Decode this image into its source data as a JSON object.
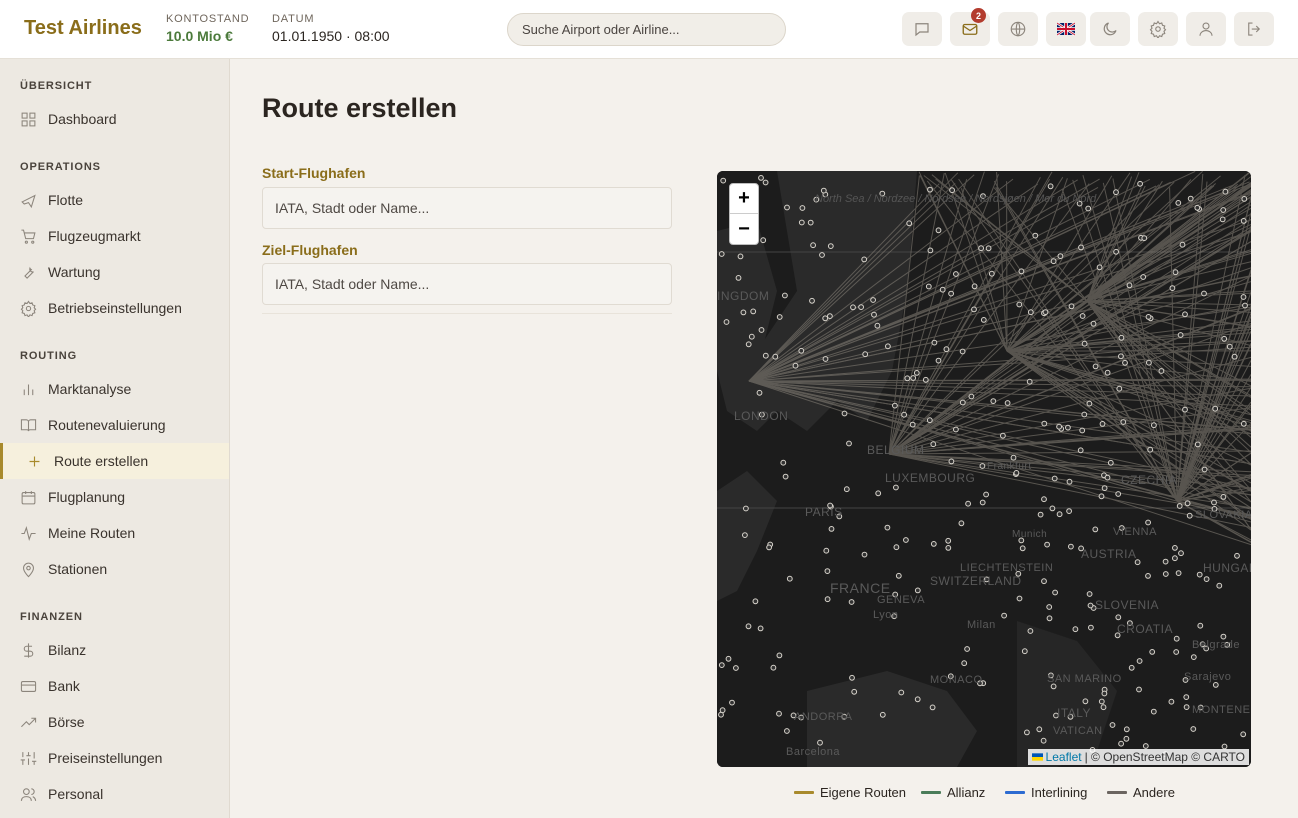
{
  "header": {
    "brand": "Test Airlines",
    "balance_label": "KONTOSTAND",
    "balance_value": "10.0 Mio €",
    "date_label": "DATUM",
    "date_value": "01.01.1950 · 08:00",
    "search_placeholder": "Suche Airport oder Airline...",
    "mail_badge": "2",
    "buttons": [
      "chat-icon",
      "mail-icon",
      "globe-icon",
      "uk-flag-icon",
      "moon-icon",
      "gear-icon",
      "user-icon",
      "logout-icon"
    ]
  },
  "sidebar": {
    "sections": [
      {
        "title": "ÜBERSICHT",
        "items": [
          {
            "label": "Dashboard",
            "icon": "grid-icon"
          }
        ]
      },
      {
        "title": "OPERATIONS",
        "items": [
          {
            "label": "Flotte",
            "icon": "plane-icon"
          },
          {
            "label": "Flugzeugmarkt",
            "icon": "cart-icon"
          },
          {
            "label": "Wartung",
            "icon": "wrench-icon"
          },
          {
            "label": "Betriebseinstellungen",
            "icon": "gear-icon"
          }
        ]
      },
      {
        "title": "ROUTING",
        "items": [
          {
            "label": "Marktanalyse",
            "icon": "bar-chart-icon"
          },
          {
            "label": "Routenevaluierung",
            "icon": "book-icon"
          },
          {
            "label": "Route erstellen",
            "icon": "plus-icon",
            "active": true
          },
          {
            "label": "Flugplanung",
            "icon": "calendar-icon"
          },
          {
            "label": "Meine Routen",
            "icon": "activity-icon"
          },
          {
            "label": "Stationen",
            "icon": "map-pin-icon"
          }
        ]
      },
      {
        "title": "FINANZEN",
        "items": [
          {
            "label": "Bilanz",
            "icon": "dollar-icon"
          },
          {
            "label": "Bank",
            "icon": "credit-card-icon"
          },
          {
            "label": "Börse",
            "icon": "trending-up-icon"
          },
          {
            "label": "Preiseinstellungen",
            "icon": "sliders-icon"
          },
          {
            "label": "Personal",
            "icon": "users-icon"
          }
        ]
      }
    ]
  },
  "main": {
    "title": "Route erstellen",
    "start_label": "Start-Flughafen",
    "start_placeholder": "IATA, Stadt oder Name...",
    "dest_label": "Ziel-Flughafen",
    "dest_placeholder": "IATA, Stadt oder Name..."
  },
  "map": {
    "zoom_in": "+",
    "zoom_out": "−",
    "attribution_leaflet": "Leaflet",
    "attribution_rest": "| © OpenStreetMap © CARTO",
    "labels": [
      "INGDOM",
      "LONDON",
      "BELGIUM",
      "LUXEMBOURG",
      "PARIS",
      "FRANCE",
      "SWITZERLAND",
      "LIECHTENSTEIN",
      "GENEVA",
      "Lyon",
      "AUSTRIA",
      "VIENNA",
      "SLOVENIA",
      "CROATIA",
      "ITALY",
      "VATICAN",
      "MONACO",
      "ANDORRA",
      "Barcelona",
      "Munich",
      "Milan",
      "SAN MARINO",
      "MONTENEGRO",
      "Belgrade",
      "Sarajevo",
      "CZECHIA",
      "Frankfurt",
      "HUNGARY",
      "SLOVAKIA"
    ],
    "sea_label": "North Sea / Nordzee / Nordsee / Nordsjøen / Mer du Nord"
  },
  "legend": [
    {
      "label": "Eigene Routen",
      "color": "#a88a2c"
    },
    {
      "label": "Allianz",
      "color": "#4a7c59"
    },
    {
      "label": "Interlining",
      "color": "#2c6bd1"
    },
    {
      "label": "Andere",
      "color": "#6b6560"
    }
  ]
}
